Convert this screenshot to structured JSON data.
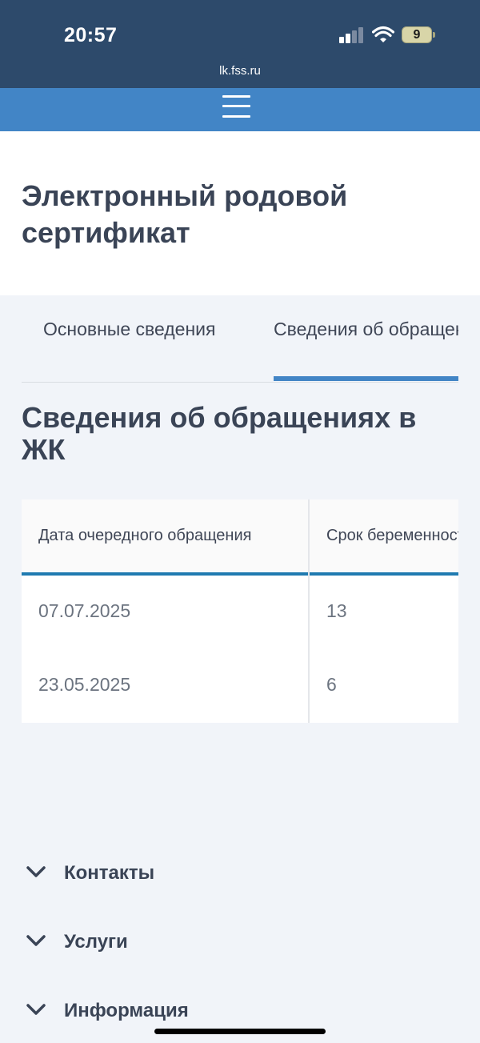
{
  "status_bar": {
    "time": "20:57",
    "battery_level": "9",
    "url": "lk.fss.ru"
  },
  "icons": {
    "menu": "hamburger-menu-icon",
    "signal": "cellular-signal-icon",
    "wifi": "wifi-icon",
    "battery": "battery-icon",
    "chevron": "chevron-down-icon"
  },
  "page": {
    "title": "Электронный родовой сертификат"
  },
  "tabs": [
    {
      "label": "Основные сведения",
      "active": false
    },
    {
      "label": "Сведения об обращениях",
      "active": true
    }
  ],
  "section": {
    "title": "Сведения об обращениях в ЖК"
  },
  "table": {
    "columns": [
      "Дата очередного обращения",
      "Срок беременности"
    ],
    "rows": [
      [
        "07.07.2025",
        "13"
      ],
      [
        "23.05.2025",
        "6"
      ]
    ]
  },
  "footer": {
    "items": [
      {
        "label": "Контакты"
      },
      {
        "label": "Услуги"
      },
      {
        "label": "Информация"
      }
    ]
  },
  "colors": {
    "status_bar_bg": "#2d4a6b",
    "nav_bar_bg": "#4285c6",
    "page_bg": "#f1f4f9",
    "text_dark": "#3a4456",
    "text_muted": "#6c7480",
    "table_header_line": "#1f7ab0",
    "tab_active_underline": "#4285c6"
  }
}
